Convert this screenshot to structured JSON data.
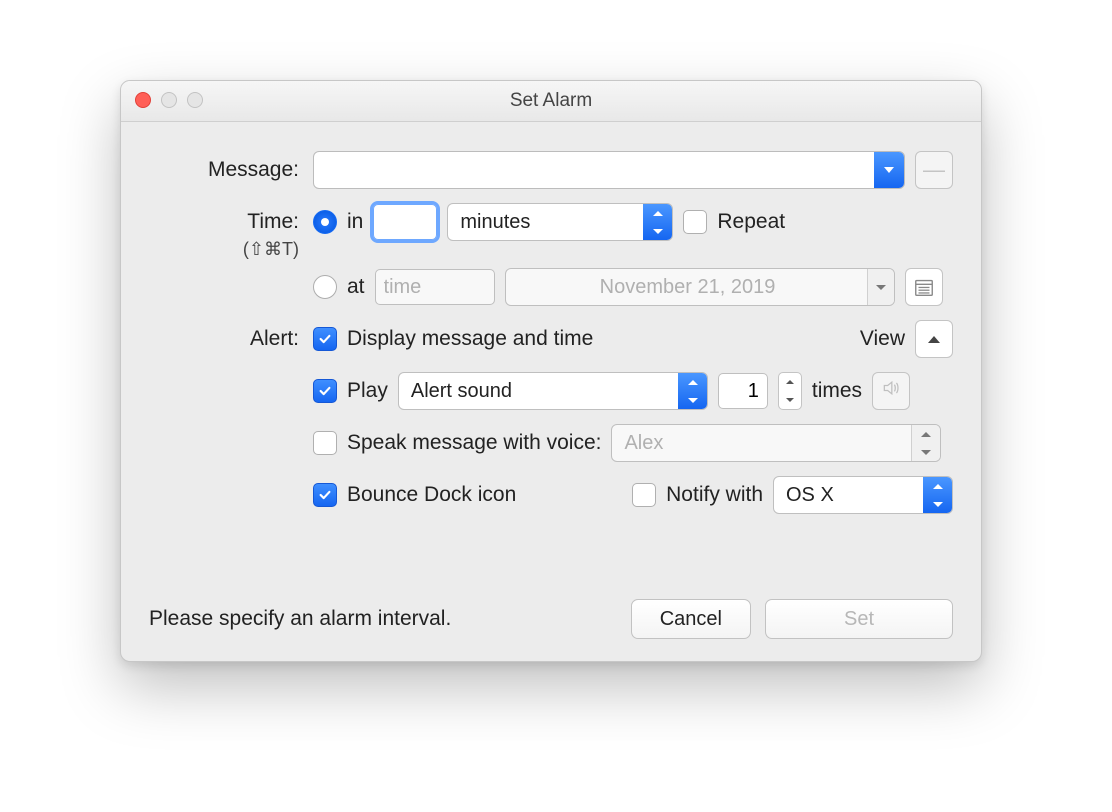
{
  "window": {
    "title": "Set Alarm"
  },
  "labels": {
    "message": "Message:",
    "time": "Time:",
    "shortcut": "(⇧⌘T)",
    "alert": "Alert:",
    "in": "in",
    "at": "at",
    "repeat": "Repeat",
    "display_msg": "Display message and time",
    "view": "View",
    "play": "Play",
    "times": "times",
    "speak": "Speak message with voice:",
    "bounce": "Bounce Dock icon",
    "notify_with": "Notify with",
    "status": "Please specify an alarm interval.",
    "cancel": "Cancel",
    "set": "Set"
  },
  "values": {
    "message": "",
    "interval_number": "",
    "interval_unit": "minutes",
    "at_time_placeholder": "time",
    "at_date": "November 21, 2019",
    "play_sound": "Alert sound",
    "play_count": "1",
    "voice": "Alex",
    "notify_service": "OS X"
  },
  "state": {
    "time_mode": "in",
    "repeat": false,
    "display_msg": true,
    "play": true,
    "speak": false,
    "bounce": true,
    "notify": false
  }
}
